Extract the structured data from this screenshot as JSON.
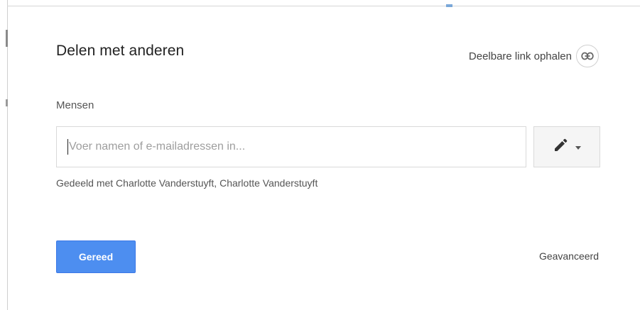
{
  "dialog": {
    "title": "Delen met anderen",
    "share_link_label": "Deelbare link ophalen",
    "people_label": "Mensen",
    "input_placeholder": "Voer namen of e-mailadressen in...",
    "shared_with_text": "Gedeeld met Charlotte Vanderstuyft, Charlotte Vanderstuyft",
    "done_button_label": "Gereed",
    "advanced_label": "Geavanceerd",
    "permission_icon": "pencil-icon",
    "dropdown_icon": "caret-down-icon",
    "link_icon": "link-icon"
  },
  "colors": {
    "primary_button": "#4d8ef0",
    "title_text": "#222222",
    "secondary_text": "#555555"
  }
}
